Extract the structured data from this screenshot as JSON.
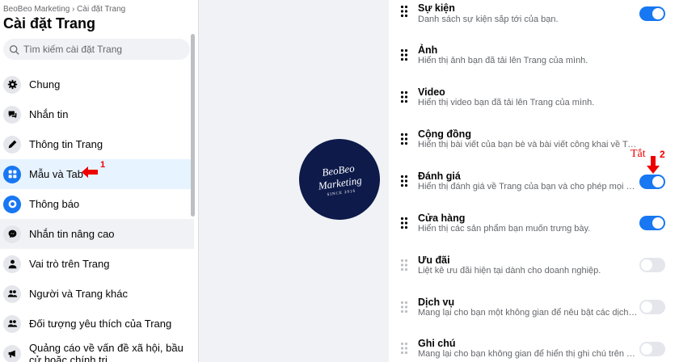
{
  "sidebar": {
    "breadcrumb": "BeoBeo Marketing › Cài đặt Trang",
    "title": "Cài đặt Trang",
    "search_placeholder": "Tìm kiếm cài đặt Trang",
    "items": [
      {
        "label": "Chung",
        "icon": "gear-icon"
      },
      {
        "label": "Nhắn tin",
        "icon": "chat-icon"
      },
      {
        "label": "Thông tin Trang",
        "icon": "pencil-icon"
      },
      {
        "label": "Mẫu và Tab",
        "icon": "grid-icon"
      },
      {
        "label": "Thông báo",
        "icon": "globe-icon"
      },
      {
        "label": "Nhắn tin nâng cao",
        "icon": "messenger-icon"
      },
      {
        "label": "Vai trò trên Trang",
        "icon": "person-icon"
      },
      {
        "label": "Người và Trang khác",
        "icon": "people-icon"
      },
      {
        "label": "Đối tượng yêu thích của Trang",
        "icon": "people-icon"
      },
      {
        "label": "Quảng cáo về vấn đề xã hội, bầu cử hoặc chính trị",
        "icon": "megaphone-icon"
      }
    ]
  },
  "annotations": {
    "marker1": "1",
    "marker2": "2",
    "off_label": "Tắt"
  },
  "logo": {
    "line1": "BeoBeo",
    "line2": "Marketing",
    "line3": "SINCE 2016"
  },
  "tabs": [
    {
      "title": "Sự kiện",
      "desc": "Danh sách sự kiện sắp tới của bạn.",
      "enabled": true
    },
    {
      "title": "Ảnh",
      "desc": "Hiển thị ảnh bạn đã tải lên Trang của mình.",
      "enabled": null
    },
    {
      "title": "Video",
      "desc": "Hiển thị video bạn đã tải lên Trang của mình.",
      "enabled": null
    },
    {
      "title": "Cộng đồng",
      "desc": "Hiển thị bài viết của bạn bè và bài viết công khai về Trang của bạn.",
      "enabled": null
    },
    {
      "title": "Đánh giá",
      "desc": "Hiển thị đánh giá về Trang của bạn và cho phép mọi người viết đánh giá.",
      "enabled": true
    },
    {
      "title": "Cửa hàng",
      "desc": "Hiển thị các sản phẩm bạn muốn trưng bày.",
      "enabled": true
    },
    {
      "title": "Ưu đãi",
      "desc": "Liệt kê ưu đãi hiện tại dành cho doanh nghiệp.",
      "enabled": false
    },
    {
      "title": "Dịch vụ",
      "desc": "Mang lại cho bạn một không gian để nêu bật các dịch vụ bạn cung cấp.",
      "enabled": false
    },
    {
      "title": "Ghi chú",
      "desc": "Mang lại cho bạn không gian để hiển thị ghi chú trên Trang.",
      "enabled": false
    }
  ],
  "colors": {
    "accent": "#1877f2",
    "annotation": "#ee0000",
    "logo_bg": "#0d1a4a"
  }
}
